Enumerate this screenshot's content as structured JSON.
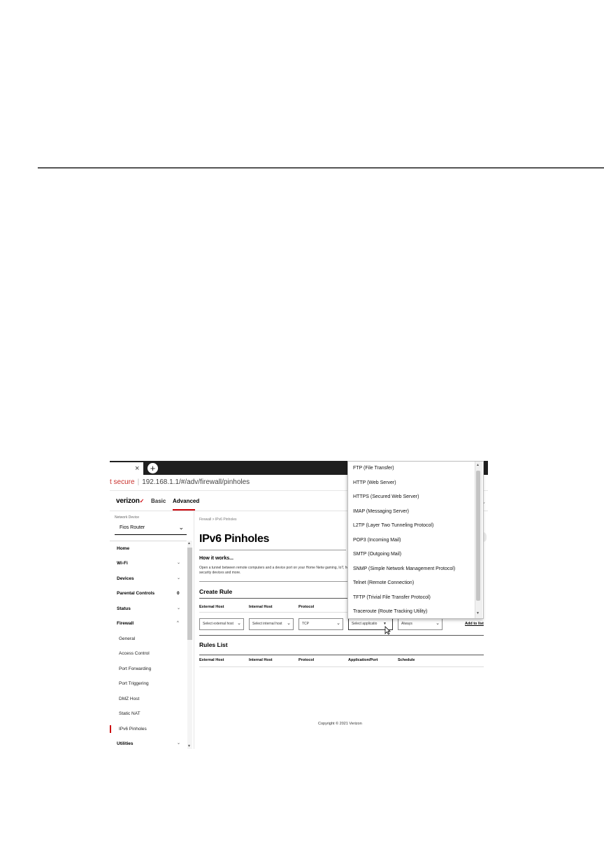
{
  "browser": {
    "tab_close": "×",
    "new_tab": "+",
    "not_secure": "t secure",
    "separator": "|",
    "url": "192.168.1.1/#/adv/firewall/pinholes"
  },
  "header": {
    "logo": "verizon",
    "logo_check": "✓",
    "nav_basic": "Basic",
    "nav_advanced": "Advanced",
    "right_chevron": "⌄"
  },
  "sidebar": {
    "network_device_label": "Network Device",
    "network_device_value": "Fios Router",
    "menu": {
      "home": "Home",
      "wifi": "Wi-Fi",
      "devices": "Devices",
      "parental_controls": "Parental Controls",
      "parental_controls_count": "0",
      "status": "Status",
      "firewall": "Firewall",
      "utilities": "Utilities"
    },
    "firewall_sub": {
      "general": "General",
      "access_control": "Access Control",
      "port_forwarding": "Port Forwarding",
      "port_triggering": "Port Triggering",
      "dmz_host": "DMZ Host",
      "static_nat": "Static NAT",
      "ipv6_pinholes": "IPv6 Pinholes"
    }
  },
  "main": {
    "breadcrumb": "Firewall  >  IPv6 Pinholes",
    "title": "IPv6 Pinholes",
    "how_title": "How it works...",
    "how_text": "Open a tunnel between remote computers and a device port on your Home Netw gaming, IoT, home security devices and more.",
    "create_rule": "Create Rule",
    "columns": {
      "external_host": "External Host",
      "internal_host": "Internal Host",
      "protocol": "Protocol",
      "application_port": "Application/Port",
      "schedule": "Schedule"
    },
    "selects": {
      "external_host": "Select external host",
      "internal_host": "Select internal host",
      "protocol": "TCP",
      "application": "Select applicatio",
      "schedule": "Always"
    },
    "add_to_list": "Add to list",
    "rules_list": "Rules List",
    "copyright": "Copyright © 2021 Verizon"
  },
  "dropdown": {
    "options": [
      "FTP (File Transfer)",
      "HTTP (Web Server)",
      "HTTPS (Secured Web Server)",
      "IMAP (Messaging Server)",
      "L2TP (Layer Two Tunneling Protocol)",
      "POP3 (Incoming Mail)",
      "SMTP (Outgoing Mail)",
      "SNMP (Simple Network Management Protocol)",
      "Telnet (Remote Connection)",
      "TFTP (Trivial File Transfer Protocol)",
      "Traceroute (Route Tracking Utility)"
    ]
  },
  "icons": {
    "chevron_down": "⌄",
    "chevron_up": "^",
    "arrow_up": "▲",
    "arrow_down": "▼"
  },
  "colors": {
    "brand_red": "#cd040b",
    "not_secure_red": "#c9302c"
  }
}
